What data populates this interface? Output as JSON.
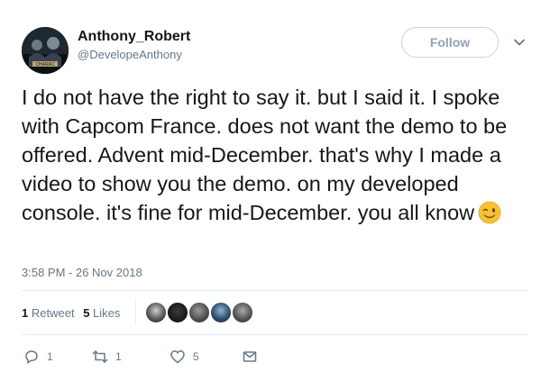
{
  "user": {
    "name": "Anthony_Robert",
    "handle": "@DevelopeAnthony",
    "avatar_caption": "CHARAC"
  },
  "header": {
    "follow_label": "Follow"
  },
  "tweet": {
    "text": "I do not have the right to say it. but I said it. I spoke with Capcom France. does not want the demo to be offered. Advent mid-December. that's why I made a video to show you the demo. on my developed console. it's fine for mid-December. you all know",
    "emoji": "winking-face",
    "timestamp": "3:58 PM - 26 Nov 2018"
  },
  "stats": {
    "retweets_count": "1",
    "retweets_label": "Retweet",
    "likes_count": "5",
    "likes_label": "Likes"
  },
  "actions": {
    "reply_count": "1",
    "retweet_count": "1",
    "like_count": "5"
  },
  "colors": {
    "text": "#14171a",
    "secondary": "#657786",
    "border": "#e6ecf0",
    "follow": "#8ea4b8"
  }
}
